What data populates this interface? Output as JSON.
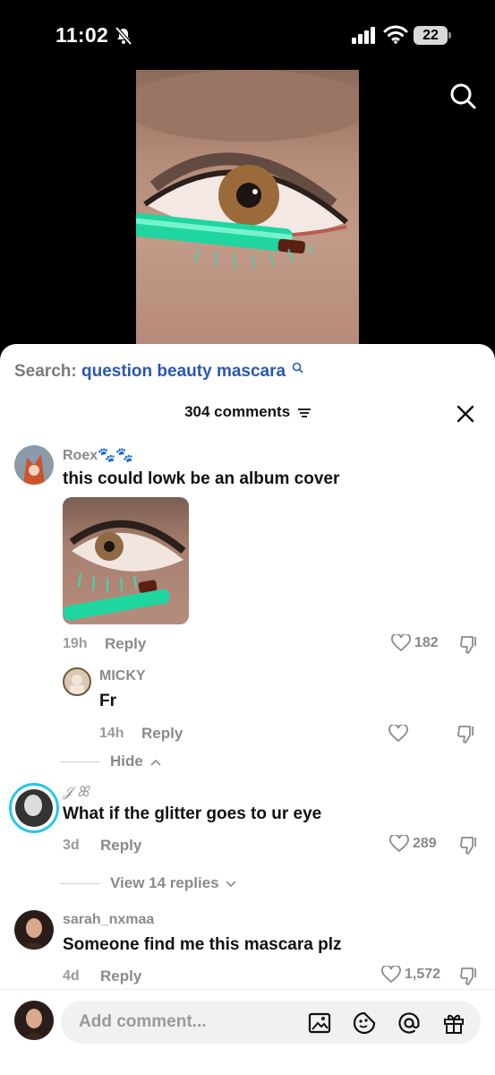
{
  "status": {
    "time": "11:02",
    "battery": "22"
  },
  "search": {
    "label": "Search:",
    "query": "question beauty mascara"
  },
  "comments_header": {
    "count_label": "304 comments"
  },
  "comments": [
    {
      "user": "Roex🐾🐾",
      "text": "this could lowk be an album cover",
      "age": "19h",
      "reply": "Reply",
      "likes": "182"
    },
    {
      "user": "MICKY",
      "text": "Fr",
      "age": "14h",
      "reply": "Reply",
      "likes": ""
    },
    {
      "user": "𝒥 ꕤ",
      "text": "What if the glitter goes to ur eye",
      "age": "3d",
      "reply": "Reply",
      "likes": "289"
    },
    {
      "user": "sarah_nxmaa",
      "text": "Someone find me this mascara plz",
      "age": "4d",
      "reply": "Reply",
      "likes": "1,572"
    }
  ],
  "threads": {
    "hide": "Hide",
    "view_replies": "View 14 replies"
  },
  "composer": {
    "placeholder": "Add comment..."
  },
  "colors": {
    "accent": "#2a57b6",
    "mascara": "#1fd6a0"
  }
}
